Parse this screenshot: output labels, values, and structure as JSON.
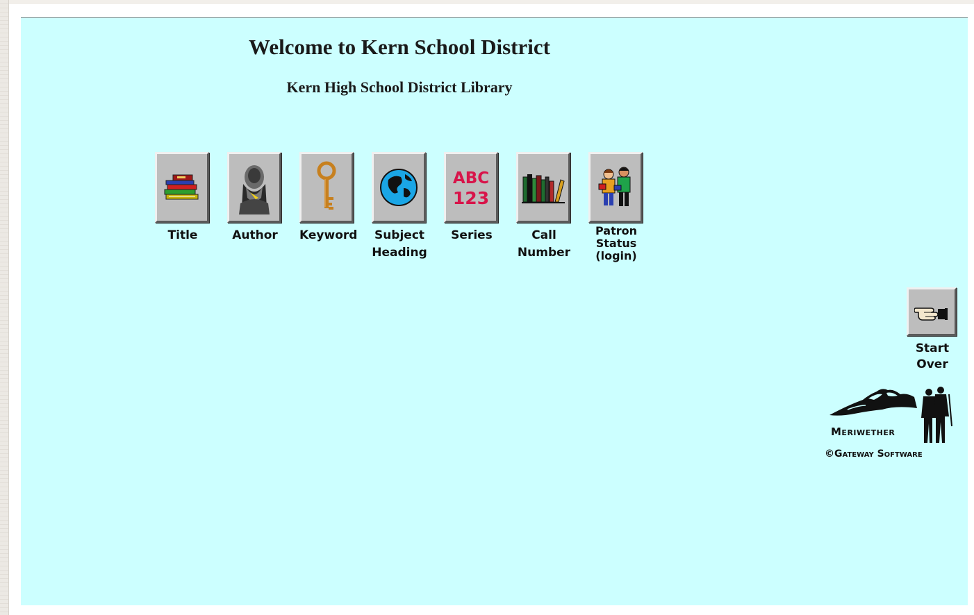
{
  "header": {
    "title": "Welcome to Kern School District",
    "subtitle": "Kern High School District Library"
  },
  "search_buttons": [
    {
      "label": "Title",
      "icon": "stacked-books-icon"
    },
    {
      "label": "Author",
      "icon": "author-portrait-icon"
    },
    {
      "label": "Keyword",
      "icon": "key-icon"
    },
    {
      "label": "Subject\nHeading",
      "icon": "globe-icon"
    },
    {
      "label": "Series",
      "icon": "abc-123-icon"
    },
    {
      "label": "Call\nNumber",
      "icon": "shelf-books-icon"
    },
    {
      "label": "Patron\nStatus\n(login)",
      "icon": "patrons-icon"
    }
  ],
  "start_over": {
    "label": "Start\nOver",
    "icon": "pointing-hand-icon"
  },
  "logo": {
    "name": "Meriwether",
    "copyright": "©Gateway Software"
  },
  "colors": {
    "page_background": "#ccffff",
    "button_face": "#bdbdbd"
  }
}
